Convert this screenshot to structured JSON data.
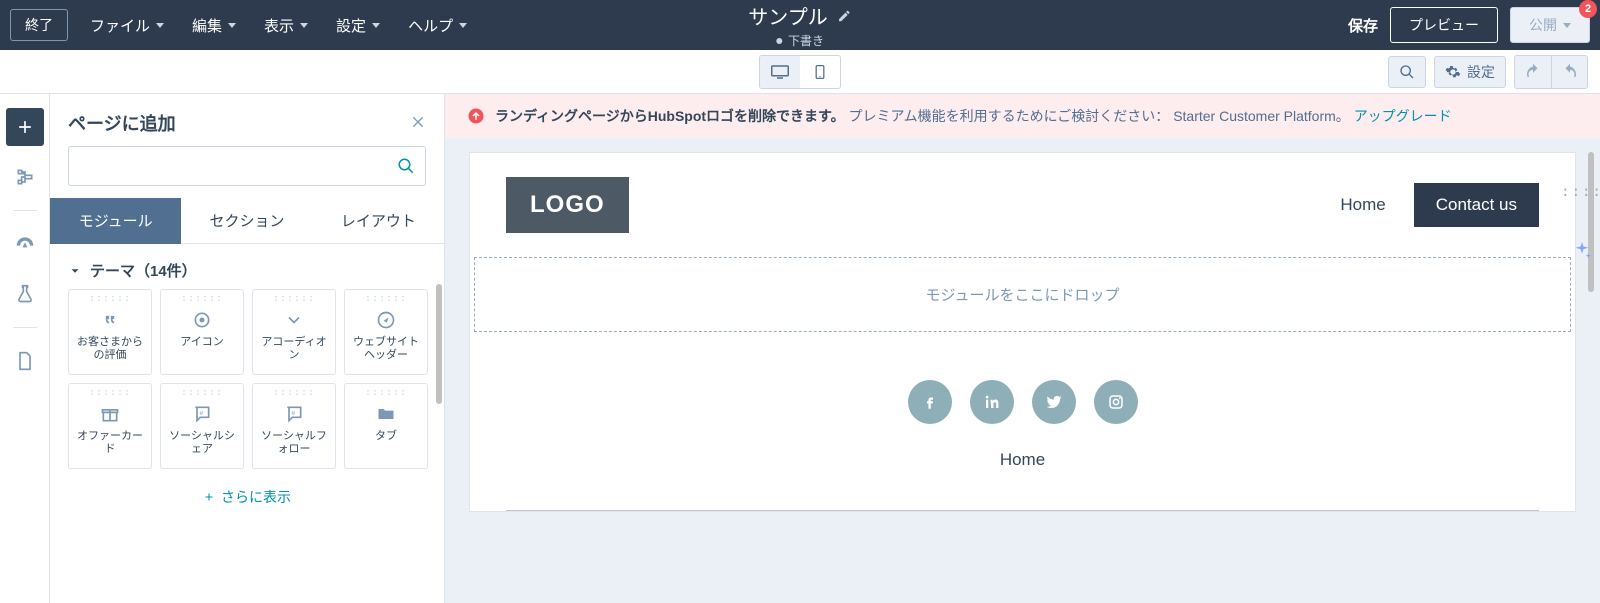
{
  "topbar": {
    "exit": "終了",
    "menu": [
      "ファイル",
      "編集",
      "表示",
      "設定",
      "ヘルプ"
    ],
    "title": "サンプル",
    "status": "下書き",
    "save": "保存",
    "preview": "プレビュー",
    "publish": "公開",
    "badge": "2"
  },
  "subbar": {
    "settings": "設定"
  },
  "sidebar": {
    "title": "ページに追加",
    "tabs": [
      "モジュール",
      "セクション",
      "レイアウト"
    ],
    "group": "テーマ（14件）",
    "modules": [
      {
        "label": "お客さまからの評価"
      },
      {
        "label": "アイコン"
      },
      {
        "label": "アコーディオン"
      },
      {
        "label": "ウェブサイトヘッダー"
      },
      {
        "label": "オファーカード"
      },
      {
        "label": "ソーシャルシェア"
      },
      {
        "label": "ソーシャルフォロー"
      },
      {
        "label": "タブ"
      }
    ],
    "show_more": "さらに表示"
  },
  "alert": {
    "bold": "ランディングページからHubSpotロゴを削除できます。",
    "text": "プレミアム機能を利用するためにご検討ください：",
    "product": "Starter Customer Platform。",
    "link": "アップグレード"
  },
  "page": {
    "logo": "LOGO",
    "nav_home": "Home",
    "contact": "Contact us",
    "dropzone": "モジュールをここにドロップ",
    "footer_home": "Home"
  }
}
